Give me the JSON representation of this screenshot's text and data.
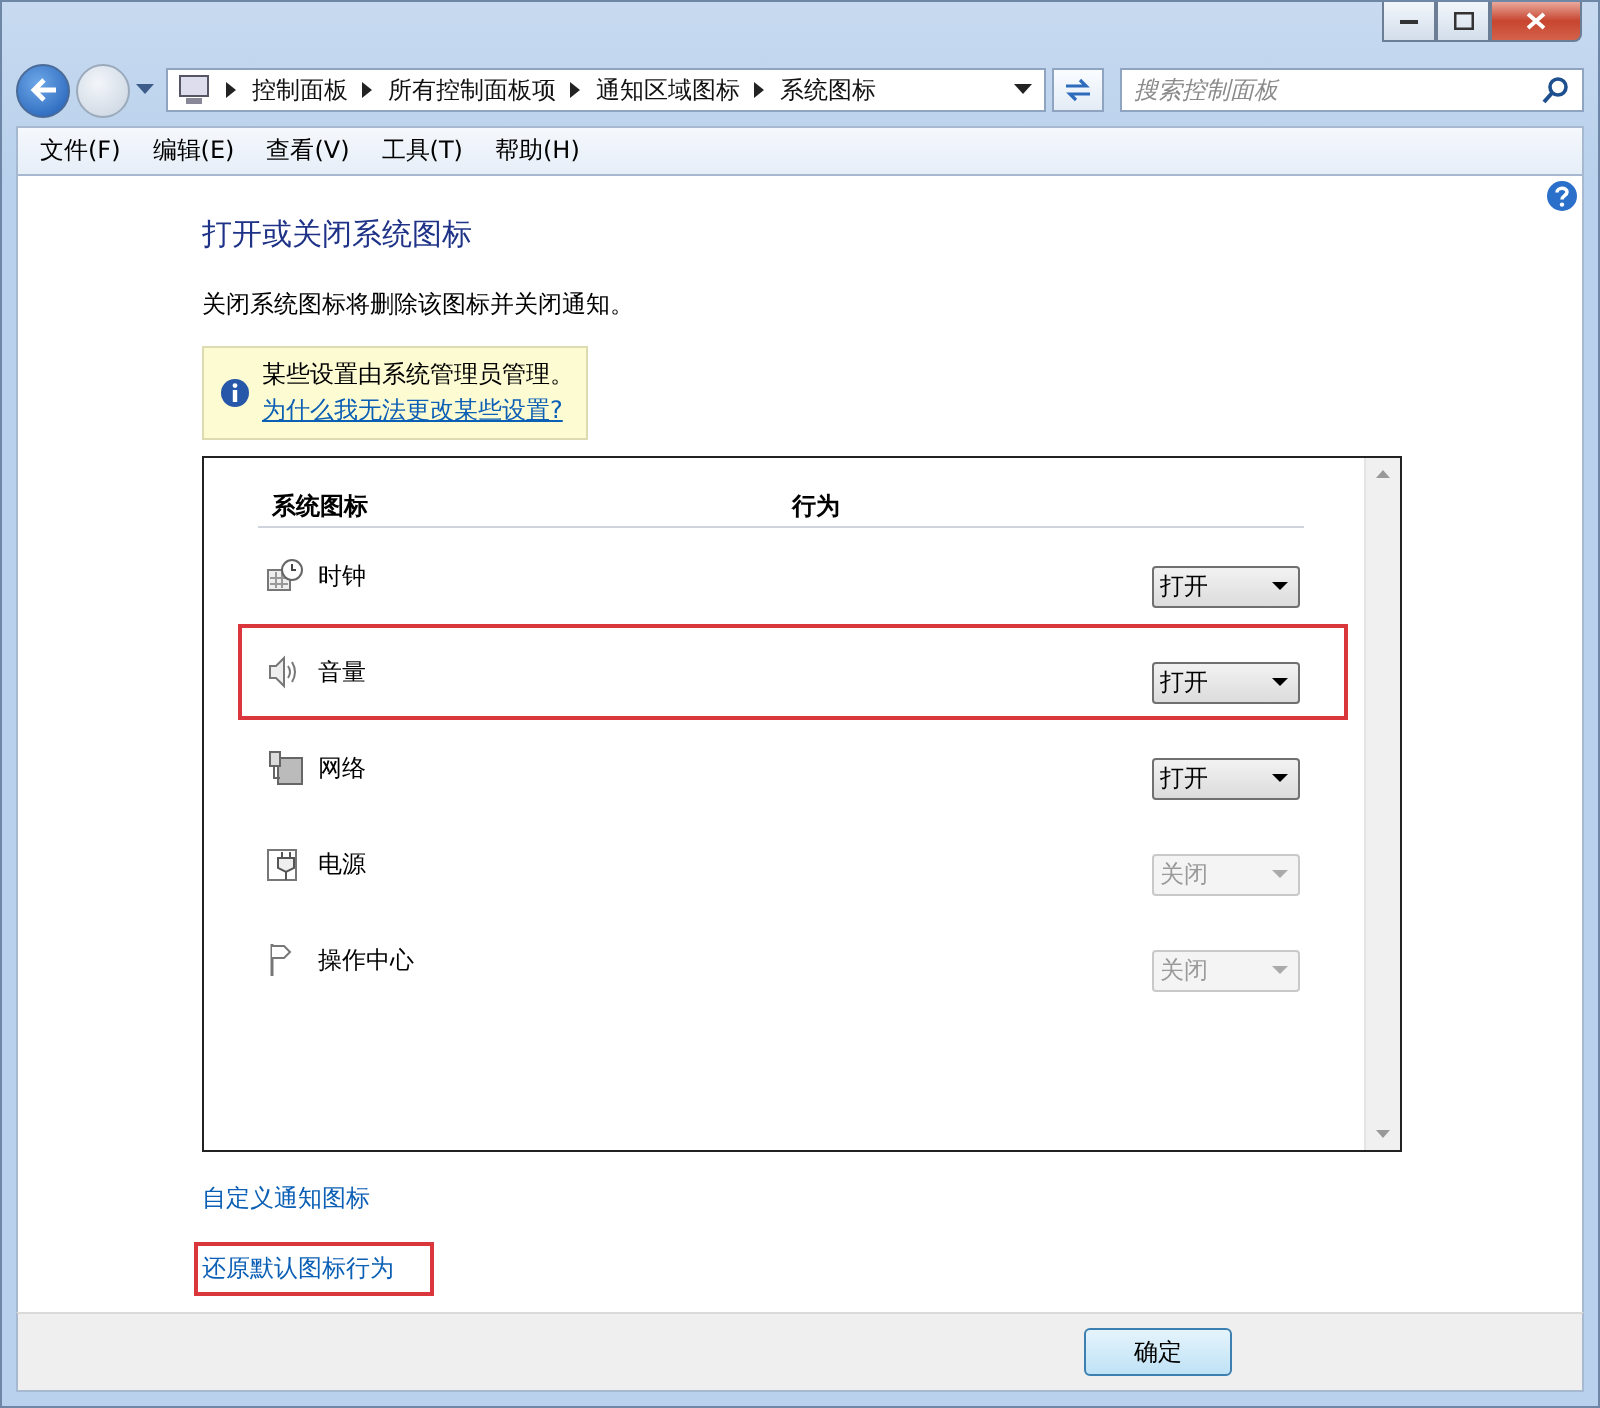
{
  "address_bar": {
    "breadcrumbs": [
      "控制面板",
      "所有控制面板项",
      "通知区域图标",
      "系统图标"
    ]
  },
  "search": {
    "placeholder": "搜索控制面板"
  },
  "menu": [
    "文件(F)",
    "编辑(E)",
    "查看(V)",
    "工具(T)",
    "帮助(H)"
  ],
  "heading": "打开或关闭系统图标",
  "description": "关闭系统图标将删除该图标并关闭通知。",
  "info": {
    "text": "某些设置由系统管理员管理。",
    "link": "为什么我无法更改某些设置?"
  },
  "table": {
    "columns": [
      "系统图标",
      "行为"
    ],
    "rows": [
      {
        "kind": "clock",
        "name": "时钟",
        "behavior": "打开",
        "disabled": false,
        "highlighted": false
      },
      {
        "kind": "volume",
        "name": "音量",
        "behavior": "打开",
        "disabled": false,
        "highlighted": true
      },
      {
        "kind": "network",
        "name": "网络",
        "behavior": "打开",
        "disabled": false,
        "highlighted": false
      },
      {
        "kind": "power",
        "name": "电源",
        "behavior": "关闭",
        "disabled": true,
        "highlighted": false
      },
      {
        "kind": "action_center",
        "name": "操作中心",
        "behavior": "关闭",
        "disabled": true,
        "highlighted": false
      }
    ]
  },
  "links": [
    {
      "text": "自定义通知图标",
      "highlighted": false
    },
    {
      "text": "还原默认图标行为",
      "highlighted": true
    }
  ],
  "buttons": [
    "确定"
  ]
}
